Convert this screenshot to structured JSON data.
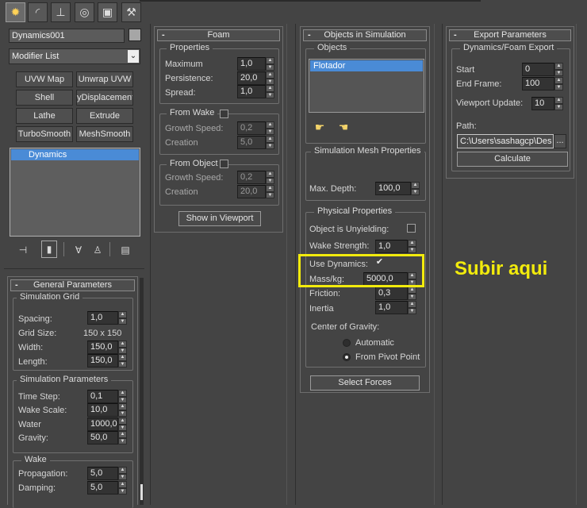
{
  "toolbar": {
    "tabs": [
      "create-icon",
      "modify-icon",
      "hierarchy-icon",
      "motion-icon",
      "display-icon",
      "utilities-icon"
    ]
  },
  "left": {
    "object_name": "Dynamics001",
    "modifier_list": "Modifier List",
    "buttons": [
      "UVW Map",
      "Unwrap UVW",
      "Shell",
      "yDisplacement",
      "Lathe",
      "Extrude",
      "TurboSmooth",
      "MeshSmooth"
    ],
    "stack_item": "Dynamics",
    "general": {
      "title": "General Parameters",
      "sim_grid": "Simulation Grid",
      "spacing_label": "Spacing:",
      "spacing": "1,0",
      "grid_size_label": "Grid Size:",
      "grid_size": "150 x 150",
      "width_label": "Width:",
      "width": "150,0",
      "length_label": "Length:",
      "length": "150,0",
      "sim_params": "Simulation Parameters",
      "time_step_label": "Time Step:",
      "time_step": "0,1",
      "wake_scale_label": "Wake Scale:",
      "wake_scale": "10,0",
      "water_label": "Water",
      "water": "1000,0",
      "gravity_label": "Gravity:",
      "gravity": "50,0",
      "wake": "Wake",
      "propagation_label": "Propagation:",
      "propagation": "5,0",
      "damping_label": "Damping:",
      "damping": "5,0"
    }
  },
  "foam": {
    "title": "Foam",
    "properties": "Properties",
    "maximum_label": "Maximum",
    "maximum": "1,0",
    "persistence_label": "Persistence:",
    "persistence": "20,0",
    "spread_label": "Spread:",
    "spread": "1,0",
    "from_wake": "From Wake",
    "fw_growth_label": "Growth Speed:",
    "fw_growth": "0,2",
    "fw_creation_label": "Creation",
    "fw_creation": "5,0",
    "from_object": "From Object",
    "fo_growth_label": "Growth Speed:",
    "fo_growth": "0,2",
    "fo_creation_label": "Creation",
    "fo_creation": "20,0",
    "show_in_viewport": "Show in Viewport"
  },
  "objects": {
    "title": "Objects in Simulation",
    "objects_group": "Objects",
    "list_item": "Flotador",
    "sim_mesh": "Simulation Mesh Properties",
    "max_depth_label": "Max. Depth:",
    "max_depth": "100,0",
    "physical": "Physical Properties",
    "unyielding_label": "Object is Unyielding:",
    "wake_strength_label": "Wake Strength:",
    "wake_strength": "1,0",
    "use_dynamics_label": "Use Dynamics:",
    "use_dynamics_check": "✔",
    "mass_label": "Mass/kg:",
    "mass": "5000,0",
    "friction_label": "Friction:",
    "friction": "0,3",
    "inertia_label": "Inertia",
    "inertia": "1,0",
    "cog_label": "Center of Gravity:",
    "automatic_label": "Automatic",
    "pivot_label": "From Pivot Point",
    "select_forces": "Select Forces"
  },
  "export": {
    "title": "Export Parameters",
    "group": "Dynamics/Foam Export",
    "start_label": "Start",
    "start": "0",
    "end_label": "End Frame:",
    "end": "100",
    "update_label": "Viewport Update:",
    "update": "10",
    "path_label": "Path:",
    "path": "C:\\Users\\sashagcp\\Des",
    "browse": "...",
    "calculate": "Calculate"
  },
  "annotation": "Subir aqui",
  "colors": {
    "highlight": "#f2eb0c",
    "selection": "#4a8bd6"
  }
}
